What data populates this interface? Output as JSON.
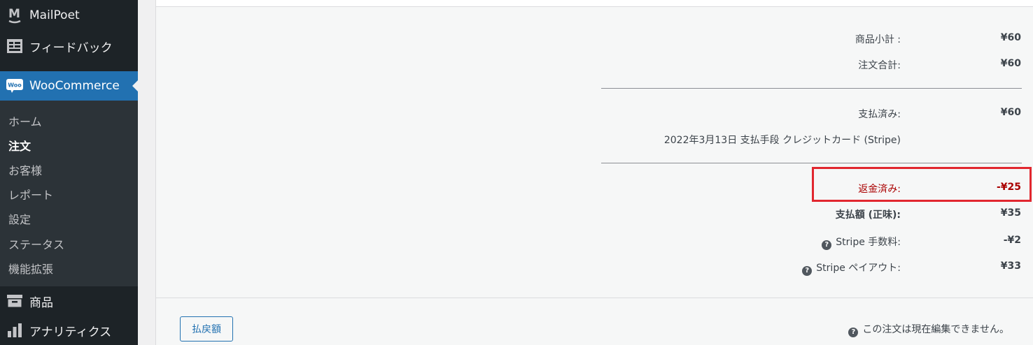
{
  "sidebar": {
    "mailpoet": "MailPoet",
    "feedback": "フィードバック",
    "woocommerce": "WooCommerce",
    "woo_icon_text": "Woo",
    "submenu": [
      "ホーム",
      "注文",
      "お客様",
      "レポート",
      "設定",
      "ステータス",
      "機能拡張"
    ],
    "current_submenu": "注文",
    "products": "商品",
    "analytics": "アナリティクス"
  },
  "totals": {
    "subtotal_label": "商品小計 :",
    "subtotal_value": "¥60",
    "order_total_label": "注文合計:",
    "order_total_value": "¥60",
    "paid_label": "支払済み:",
    "paid_value": "¥60",
    "paid_meta": "2022年3月13日 支払手段 クレジットカード (Stripe)",
    "refunded_label": "返金済み:",
    "refunded_value": "-¥25",
    "net_label": "支払額 (正味):",
    "net_value": "¥35",
    "fee_label": "Stripe 手数料:",
    "fee_value": "-¥2",
    "payout_label": "Stripe ペイアウト:",
    "payout_value": "¥33"
  },
  "actions": {
    "refund_button": "払戻額",
    "not_editable": "この注文は現在編集できません。"
  },
  "icons": {
    "help": "?"
  },
  "colors": {
    "sidebar_bg": "#1d2327",
    "active_menu": "#2271b1",
    "highlight_box": "#e1272f",
    "refund_text": "#aa0000"
  }
}
